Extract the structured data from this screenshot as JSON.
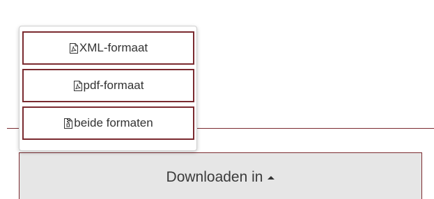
{
  "download_menu": {
    "items": [
      {
        "label": "XML-formaat",
        "icon": "file-pdf-icon"
      },
      {
        "label": "pdf-formaat",
        "icon": "file-pdf-icon"
      },
      {
        "label": "beide formaten",
        "icon": "file-archive-icon"
      }
    ]
  },
  "download_button": {
    "label": "Downloaden in",
    "caret_icon": "caret-up-icon"
  },
  "colors": {
    "accent": "#7a2a2f",
    "button_background": "#e6e6e6"
  }
}
